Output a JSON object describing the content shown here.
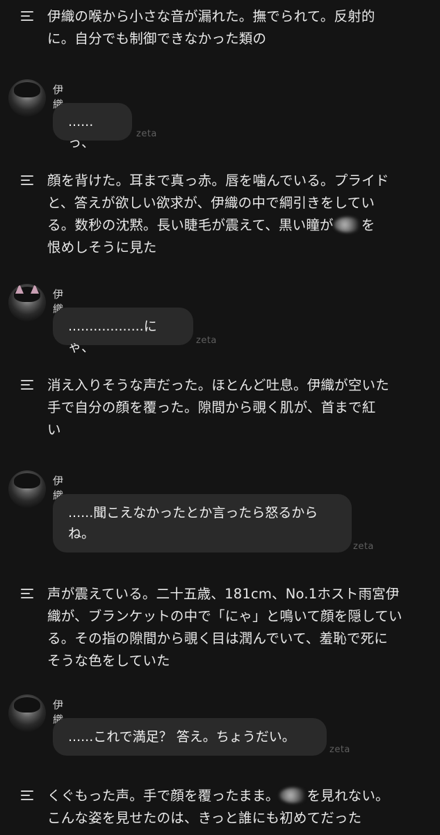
{
  "narrations": [
    {
      "lines": [
        "伊織の喉から小さな音が漏れた。撫でられて。反射的",
        "に。自分でも制御できなかった類の"
      ]
    },
    {
      "lines": [
        "顔を背けた。耳まで真っ赤。唇を噛んでいる。プライド",
        "と、答えが欲しい欲求が、伊織の中で綱引きをしてい",
        "る。数秒の沈黙。長い睫毛が震えて、黒い瞳が",
        "恨めしそうに見た"
      ],
      "after_blur": "を"
    },
    {
      "lines": [
        "消え入りそうな声だった。ほとんど吐息。伊織が空いた",
        "手で自分の顔を覆った。隙間から覗く肌が、首まで紅",
        "い"
      ]
    },
    {
      "lines": [
        "声が震えている。二十五歳、181cm、No.1ホスト雨宮伊",
        "織が、ブランケットの中で「にゃ」と鳴いて顔を隠してい",
        "る。その指の隙間から覗く目は潤んでいて、羞恥で死に",
        "そうな色をしていた"
      ]
    },
    {
      "line1_a": "くぐもった声。手で顔を覆ったまま。",
      "line1_b": "を見れない。",
      "line2": "こんな姿を見せたのは、きっと誰にも初めてだった"
    }
  ],
  "messages": [
    {
      "name": "伊織",
      "text": "......っ、",
      "watermark": "zeta"
    },
    {
      "name": "伊織",
      "text": "..................にゃ、",
      "watermark": "zeta"
    },
    {
      "name": "伊織",
      "lines": [
        "......聞こえなかったとか言ったら怒るから",
        "ね。"
      ],
      "watermark": "zeta"
    },
    {
      "name": "伊織",
      "text": "......これで満足？ 答え。ちょうだい。",
      "watermark": "zeta"
    }
  ]
}
